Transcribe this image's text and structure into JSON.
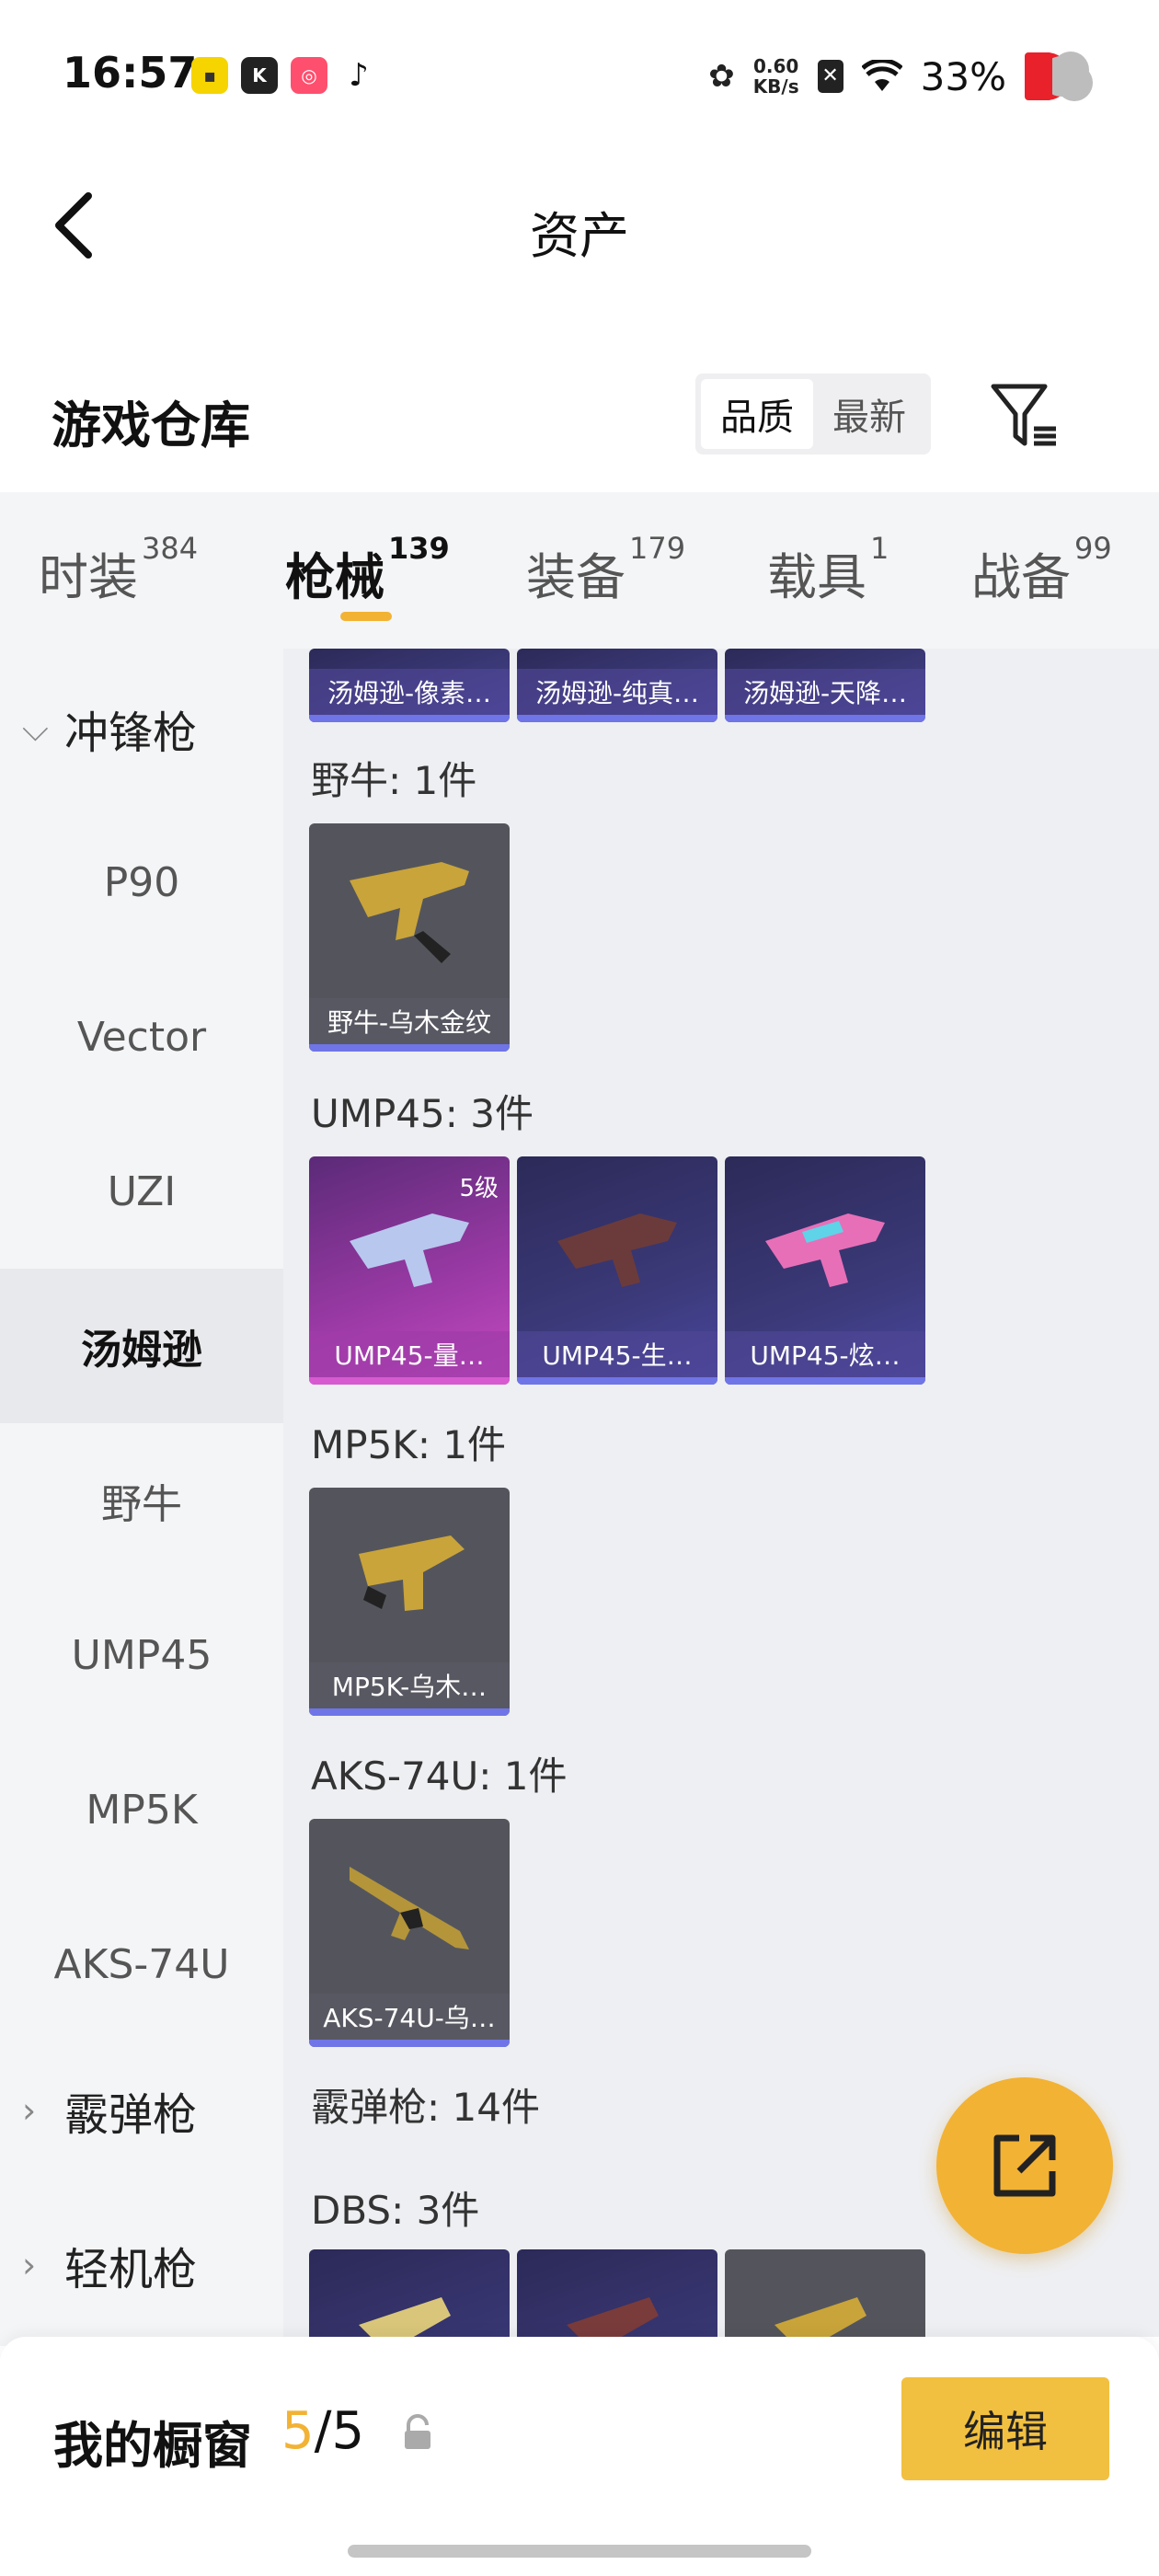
{
  "status_bar": {
    "time": "16:57",
    "net_speed_value": "0.60",
    "net_speed_unit": "KB/s",
    "battery": "33%",
    "apps": [
      "app-icon-yellow",
      "k-app-icon",
      "kuaishou-icon",
      "tiktok-icon"
    ]
  },
  "header": {
    "title": "资产"
  },
  "warehouse": {
    "title": "游戏仓库",
    "sort_options": [
      "品质",
      "最新"
    ],
    "sort_active": "品质"
  },
  "tabs": [
    {
      "label": "时装",
      "count": "384"
    },
    {
      "label": "枪械",
      "count": "139"
    },
    {
      "label": "装备",
      "count": "179"
    },
    {
      "label": "载具",
      "count": "1"
    },
    {
      "label": "战备",
      "count": "99"
    }
  ],
  "sidebar": {
    "group_smg": "冲锋枪",
    "items": [
      "P90",
      "Vector",
      "UZI",
      "汤姆逊",
      "野牛",
      "UMP45",
      "MP5K",
      "AKS-74U"
    ],
    "active": "汤姆逊",
    "group_shotgun": "霰弹枪",
    "group_lmg": "轻机枪"
  },
  "content": {
    "top_cards": [
      "汤姆逊-像素…",
      "汤姆逊-纯真…",
      "汤姆逊-天降…"
    ],
    "sections": [
      {
        "title": "野牛: 1件",
        "cards": [
          {
            "label": "野牛-乌木金纹",
            "style": "gray"
          }
        ]
      },
      {
        "title": "UMP45: 3件",
        "cards": [
          {
            "label": "UMP45-量…",
            "style": "purple",
            "level": "5级"
          },
          {
            "label": "UMP45-生…",
            "style": "blue"
          },
          {
            "label": "UMP45-炫…",
            "style": "blue"
          }
        ]
      },
      {
        "title": "MP5K: 1件",
        "cards": [
          {
            "label": "MP5K-乌木…",
            "style": "gray"
          }
        ]
      },
      {
        "title": "AKS-74U: 1件",
        "cards": [
          {
            "label": "AKS-74U-乌…",
            "style": "gray"
          }
        ]
      }
    ],
    "shotgun_title": "霰弹枪: 14件",
    "dbs_title": "DBS: 3件"
  },
  "bottom_bar": {
    "title": "我的橱窗",
    "count_current": "5",
    "count_total": "/5",
    "edit_label": "编辑"
  },
  "colors": {
    "accent": "#f2b234",
    "rarity_blue": "#6f75e6",
    "rarity_purple": "#d75ad0"
  }
}
